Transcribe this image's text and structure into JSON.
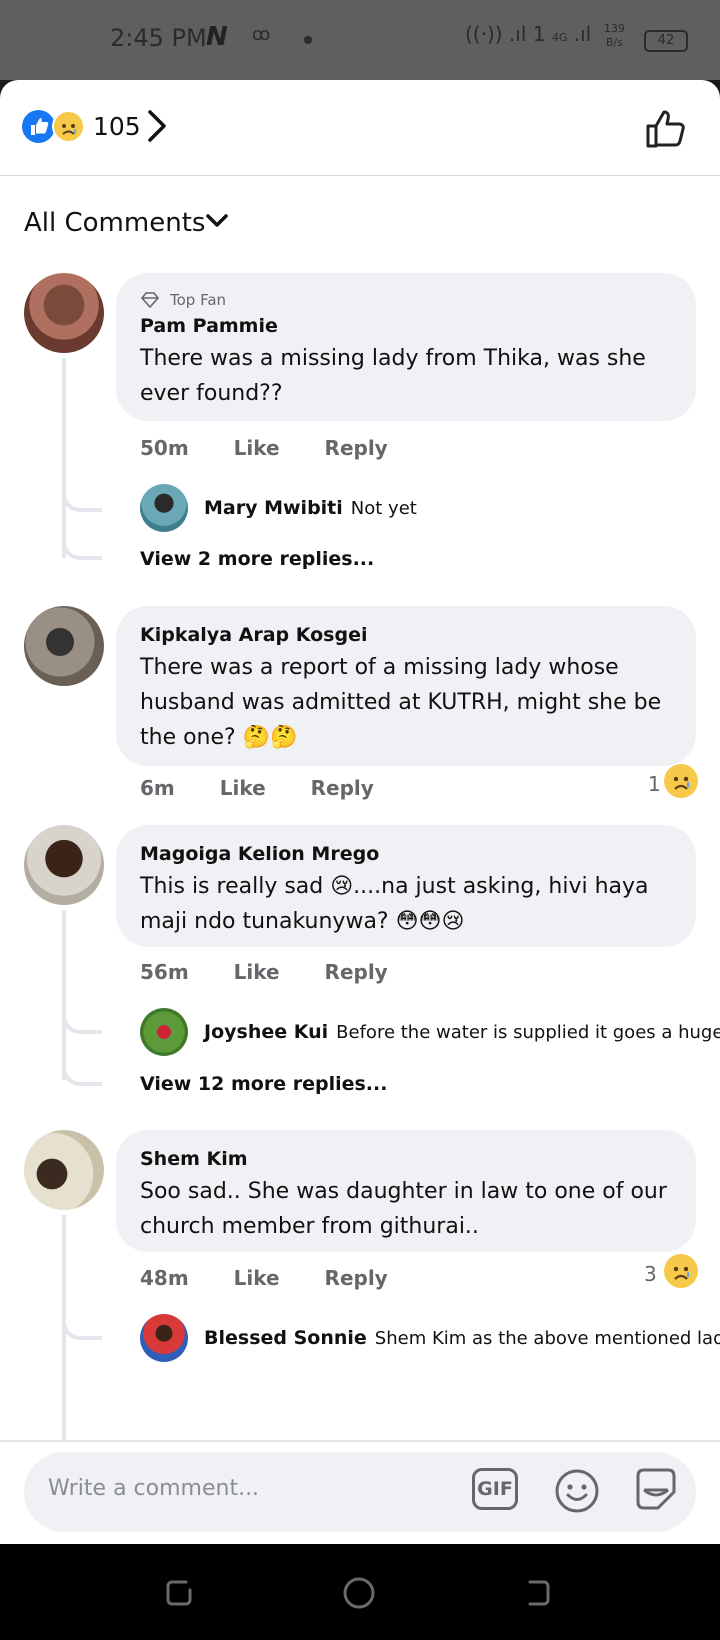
{
  "status_bar": {
    "time": "2:45 PM",
    "net_speed_value": "139",
    "net_speed_unit": "B/s",
    "battery": "42",
    "network": "4G"
  },
  "reactions": {
    "count": "105",
    "types": [
      "like-icon",
      "sad-icon"
    ]
  },
  "filter": {
    "label": "All Comments"
  },
  "comments": [
    {
      "badge": "Top Fan",
      "name": "Pam Pammie",
      "text": "There was a missing lady from Thika, was she ever found??",
      "time": "50m",
      "like": "Like",
      "reply": "Reply",
      "replies": [
        {
          "name": "Mary Mwibiti",
          "text": "Not yet"
        }
      ],
      "view_more": "View 2 more replies..."
    },
    {
      "name": "Kipkalya Arap Kosgei",
      "text": "There was a report of a missing lady whose husband was admitted at KUTRH, might she be the one? 🤔🤔",
      "time": "6m",
      "like": "Like",
      "reply": "Reply",
      "reaction_count": "1"
    },
    {
      "name": "Magoiga Kelion Mrego",
      "text": "This is really sad 😢....na just asking, hivi haya maji ndo tunakunywa? 😳😳😢",
      "time": "56m",
      "like": "Like",
      "reply": "Reply",
      "replies": [
        {
          "name": "Joyshee Kui",
          "text": "Before the water is supplied it goes a huge..."
        }
      ],
      "view_more": "View 12 more replies..."
    },
    {
      "name": "Shem Kim",
      "text": "Soo sad.. She was daughter in law to one of our church member from githurai..",
      "time": "48m",
      "like": "Like",
      "reply": "Reply",
      "reaction_count": "3",
      "replies": [
        {
          "name": "Blessed Sonnie",
          "text": "Shem Kim as the above mentioned lady?"
        }
      ]
    }
  ],
  "composer": {
    "placeholder": "Write a comment...",
    "gif_label": "GIF"
  },
  "colors": {
    "accent": "#1877f2",
    "bubble": "#f0f1f4",
    "meta": "#65676b",
    "sad": "#f7c94b"
  }
}
